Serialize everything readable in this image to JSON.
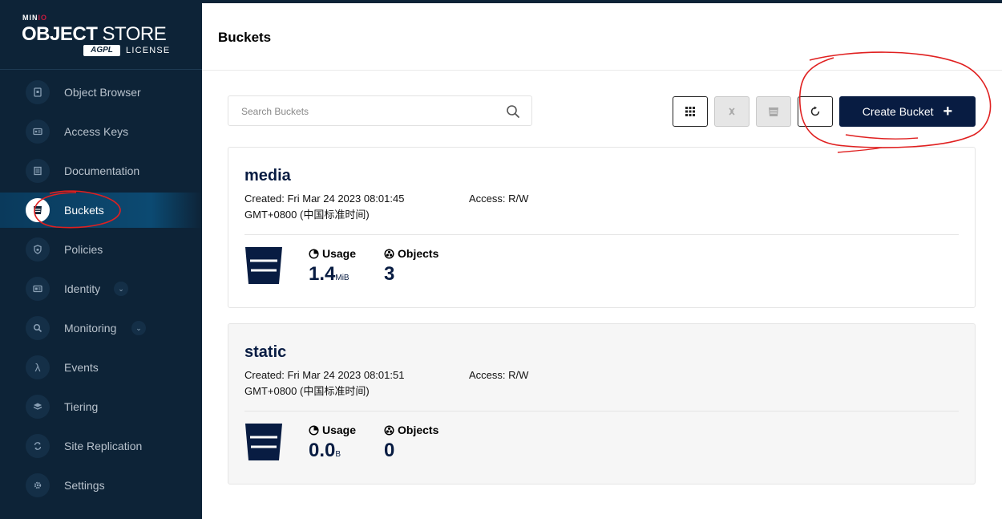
{
  "logo": {
    "brand_min": "MIN",
    "brand_io": "IO",
    "title_bold": "OBJECT",
    "title_light": " STORE",
    "badge": "AGPL",
    "license": "LICENSE"
  },
  "sidebar": {
    "items": [
      {
        "label": "Object Browser",
        "icon": "object-browser-icon"
      },
      {
        "label": "Access Keys",
        "icon": "access-keys-icon"
      },
      {
        "label": "Documentation",
        "icon": "documentation-icon"
      },
      {
        "label": "Buckets",
        "icon": "bucket-icon",
        "active": true
      },
      {
        "label": "Policies",
        "icon": "shield-icon"
      },
      {
        "label": "Identity",
        "icon": "id-card-icon",
        "expandable": true
      },
      {
        "label": "Monitoring",
        "icon": "search-icon",
        "expandable": true
      },
      {
        "label": "Events",
        "icon": "lambda-icon"
      },
      {
        "label": "Tiering",
        "icon": "layers-icon"
      },
      {
        "label": "Site Replication",
        "icon": "sync-icon"
      },
      {
        "label": "Settings",
        "icon": "gear-icon"
      }
    ]
  },
  "header": {
    "title": "Buckets"
  },
  "toolbar": {
    "search_placeholder": "Search Buckets",
    "create_label": "Create Bucket"
  },
  "buckets": [
    {
      "name": "media",
      "created_line1": "Created: Fri Mar 24 2023 08:01:45",
      "created_line2": "GMT+0800 (中国标准时间)",
      "access": "Access: R/W",
      "usage_label": "Usage",
      "usage_value": "1.4",
      "usage_unit": "MiB",
      "objects_label": "Objects",
      "objects_value": "3"
    },
    {
      "name": "static",
      "created_line1": "Created: Fri Mar 24 2023 08:01:51",
      "created_line2": "GMT+0800 (中国标准时间)",
      "access": "Access: R/W",
      "usage_label": "Usage",
      "usage_value": "0.0",
      "usage_unit": "B",
      "objects_label": "Objects",
      "objects_value": "0"
    }
  ],
  "colors": {
    "sidebar_bg": "#0d2337",
    "primary": "#081c42",
    "annotation_red": "#e02020"
  }
}
